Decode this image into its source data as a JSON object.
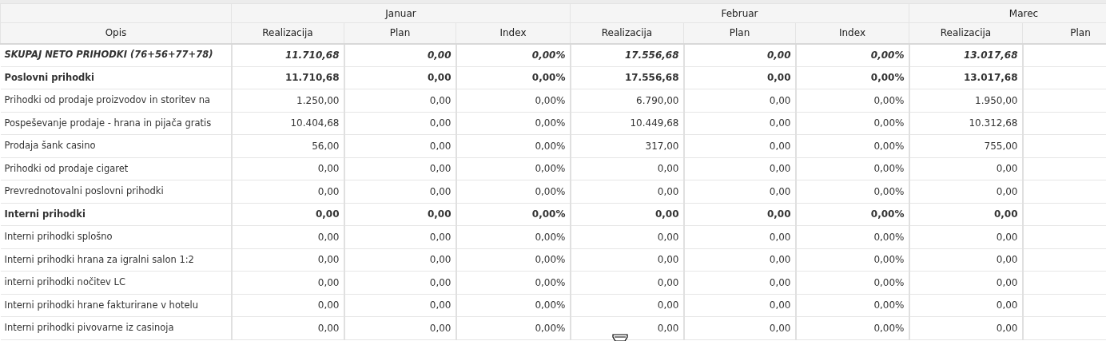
{
  "months": [
    {
      "label": "Januar"
    },
    {
      "label": "Februar"
    },
    {
      "label": "Marec"
    }
  ],
  "columns": [
    "Opis",
    "Realizacija",
    "Plan",
    "Index",
    "Realizacija",
    "Plan",
    "Index",
    "Realizacija",
    "Plan"
  ],
  "rows": [
    {
      "kind": "total",
      "label": "SKUPAJ NETO PRIHODKI (76+56+77+78)",
      "values": [
        "11.710,68",
        "0,00",
        "0,00%",
        "17.556,68",
        "0,00",
        "0,00%",
        "13.017,68"
      ]
    },
    {
      "kind": "group",
      "label": "Poslovni prihodki",
      "values": [
        "11.710,68",
        "0,00",
        "0,00%",
        "17.556,68",
        "0,00",
        "0,00%",
        "13.017,68"
      ]
    },
    {
      "kind": "item",
      "label": "Prihodki od prodaje proizvodov in storitev na",
      "values": [
        "1.250,00",
        "0,00",
        "0,00%",
        "6.790,00",
        "0,00",
        "0,00%",
        "1.950,00"
      ]
    },
    {
      "kind": "item",
      "label": "Pospeševanje prodaje - hrana in pijača gratis",
      "values": [
        "10.404,68",
        "0,00",
        "0,00%",
        "10.449,68",
        "0,00",
        "0,00%",
        "10.312,68"
      ]
    },
    {
      "kind": "item",
      "label": "Prodaja šank casino",
      "values": [
        "56,00",
        "0,00",
        "0,00%",
        "317,00",
        "0,00",
        "0,00%",
        "755,00"
      ]
    },
    {
      "kind": "item",
      "label": "Prihodki od prodaje cigaret",
      "values": [
        "0,00",
        "0,00",
        "0,00%",
        "0,00",
        "0,00",
        "0,00%",
        "0,00"
      ]
    },
    {
      "kind": "item",
      "label": "Prevrednotovalni poslovni prihodki",
      "values": [
        "0,00",
        "0,00",
        "0,00%",
        "0,00",
        "0,00",
        "0,00%",
        "0,00"
      ]
    },
    {
      "kind": "group",
      "label": "Interni prihodki",
      "values": [
        "0,00",
        "0,00",
        "0,00%",
        "0,00",
        "0,00",
        "0,00%",
        "0,00"
      ]
    },
    {
      "kind": "item",
      "label": "Interni prihodki splošno",
      "values": [
        "0,00",
        "0,00",
        "0,00%",
        "0,00",
        "0,00",
        "0,00%",
        "0,00"
      ]
    },
    {
      "kind": "item",
      "label": "Interni prihodki hrana za igralni salon 1:2",
      "values": [
        "0,00",
        "0,00",
        "0,00%",
        "0,00",
        "0,00",
        "0,00%",
        "0,00"
      ]
    },
    {
      "kind": "item",
      "label": "interni prihodki nočitev LC",
      "values": [
        "0,00",
        "0,00",
        "0,00%",
        "0,00",
        "0,00",
        "0,00%",
        "0,00"
      ]
    },
    {
      "kind": "item",
      "label": "Interni prihodki hrane fakturirane v hotelu",
      "values": [
        "0,00",
        "0,00",
        "0,00%",
        "0,00",
        "0,00",
        "0,00%",
        "0,00"
      ]
    },
    {
      "kind": "item",
      "label": "Interni prihodki pivovarne iz casinoja",
      "values": [
        "0,00",
        "0,00",
        "0,00%",
        "0,00",
        "0,00",
        "0,00%",
        "0,00"
      ]
    }
  ]
}
